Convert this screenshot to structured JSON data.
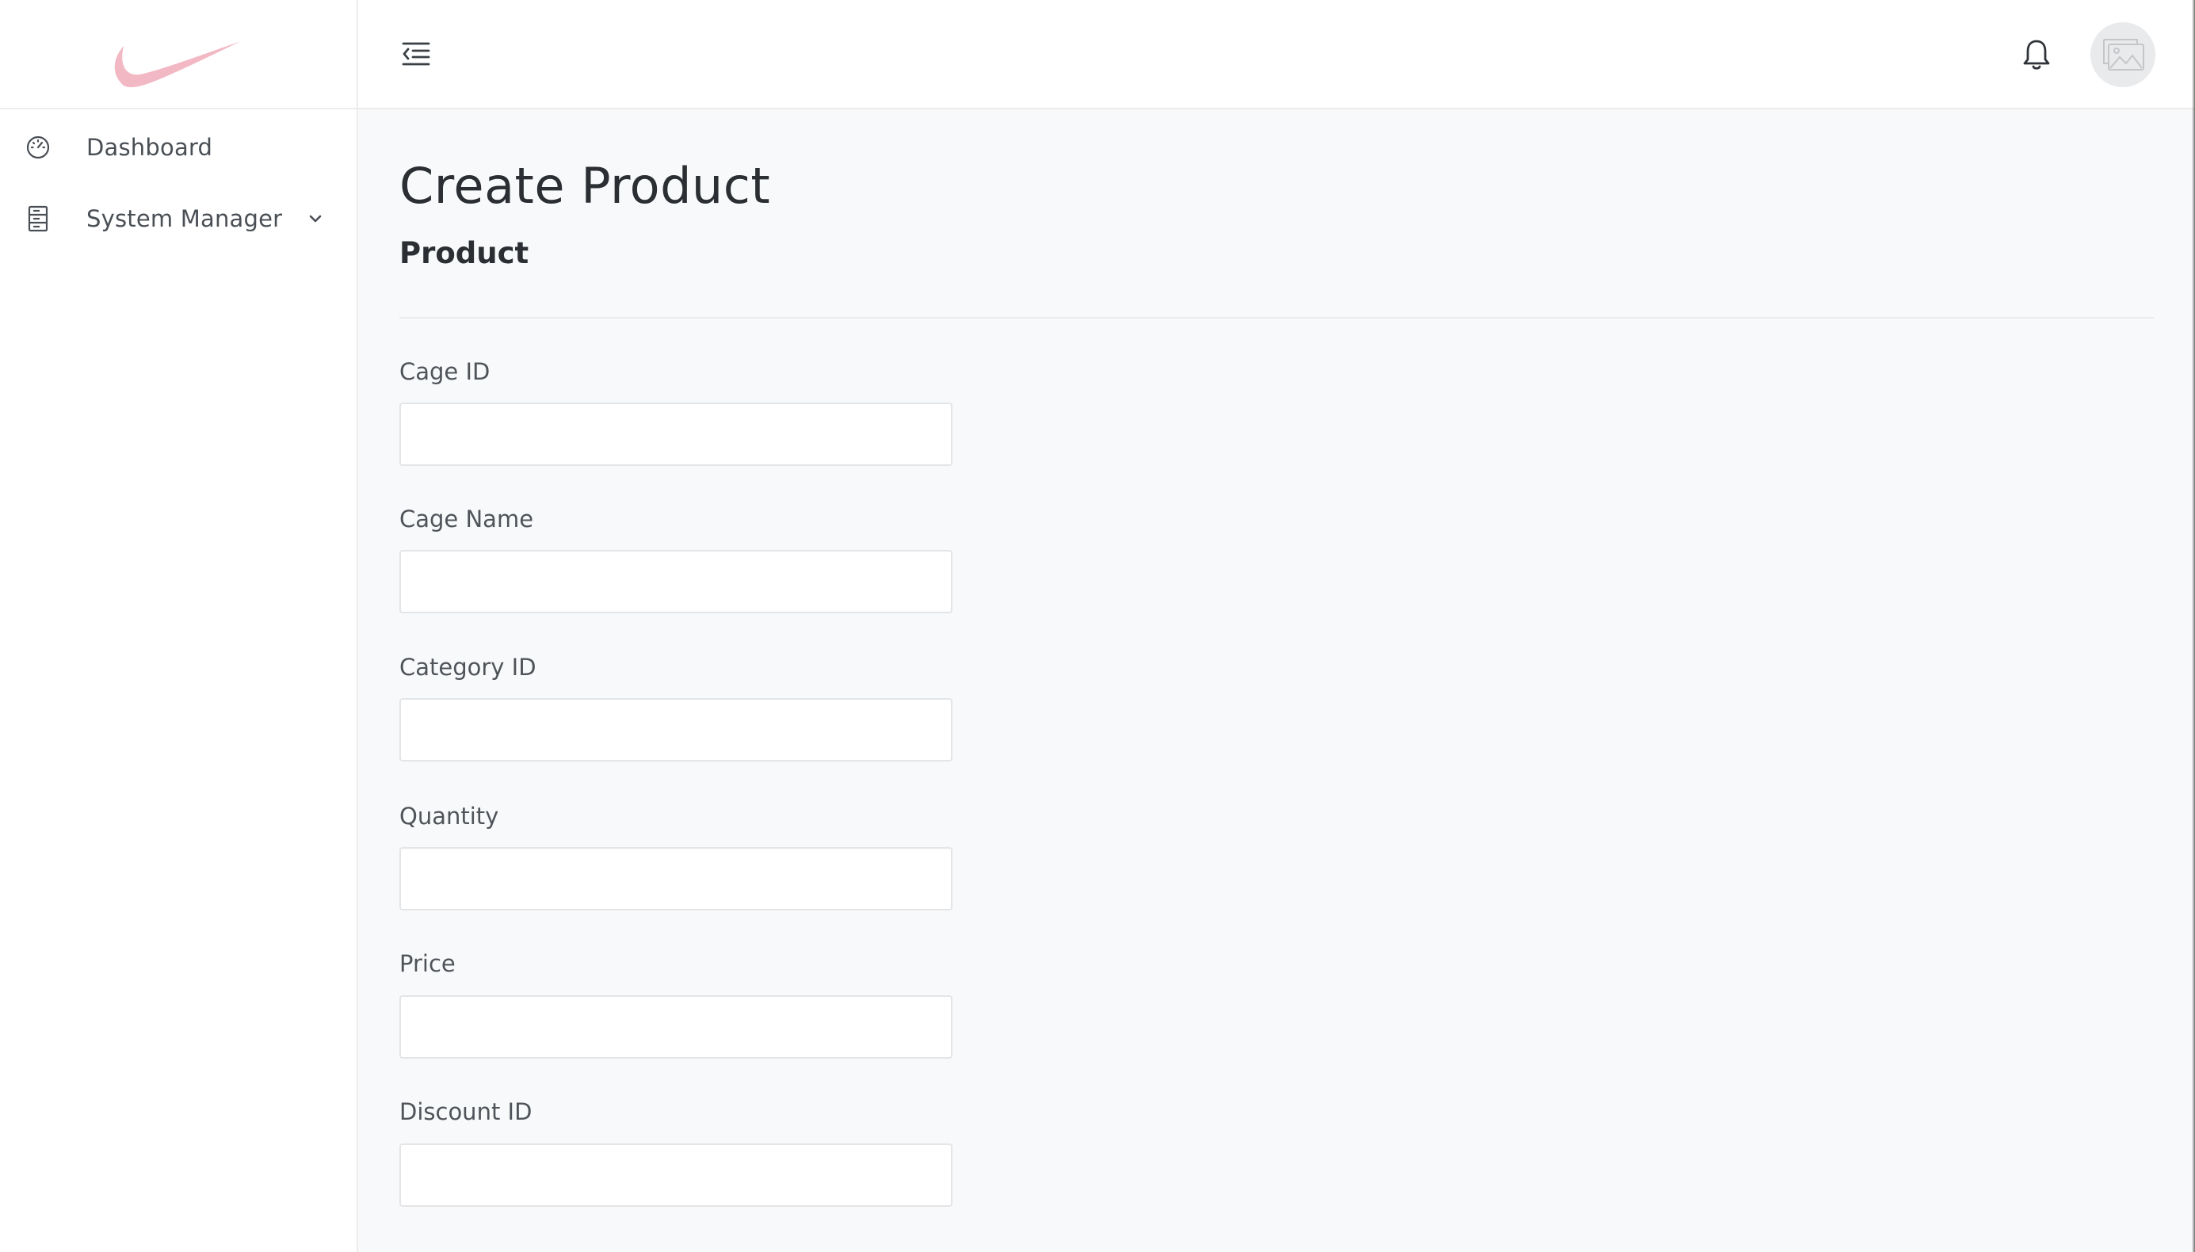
{
  "brand": {
    "logo_icon": "swoosh-logo",
    "logo_color": "#f2b8c4"
  },
  "sidebar": {
    "items": [
      {
        "label": "Dashboard",
        "icon": "gauge-icon"
      },
      {
        "label": "System Manager",
        "icon": "server-icon",
        "expandable": true
      }
    ]
  },
  "topbar": {
    "menu_icon": "menu-collapse-icon",
    "notification_icon": "bell-icon",
    "avatar_icon": "image-placeholder-icon"
  },
  "main": {
    "title": "Create Product",
    "section_title": "Product",
    "fields": [
      {
        "label": "Cage ID",
        "value": "",
        "placeholder": ""
      },
      {
        "label": "Cage Name",
        "value": "",
        "placeholder": ""
      },
      {
        "label": "Category ID",
        "value": "",
        "placeholder": ""
      },
      {
        "label": "Quantity",
        "value": "",
        "placeholder": ""
      },
      {
        "label": "Price",
        "value": "",
        "placeholder": ""
      },
      {
        "label": "Discount ID",
        "value": "",
        "placeholder": ""
      }
    ]
  }
}
